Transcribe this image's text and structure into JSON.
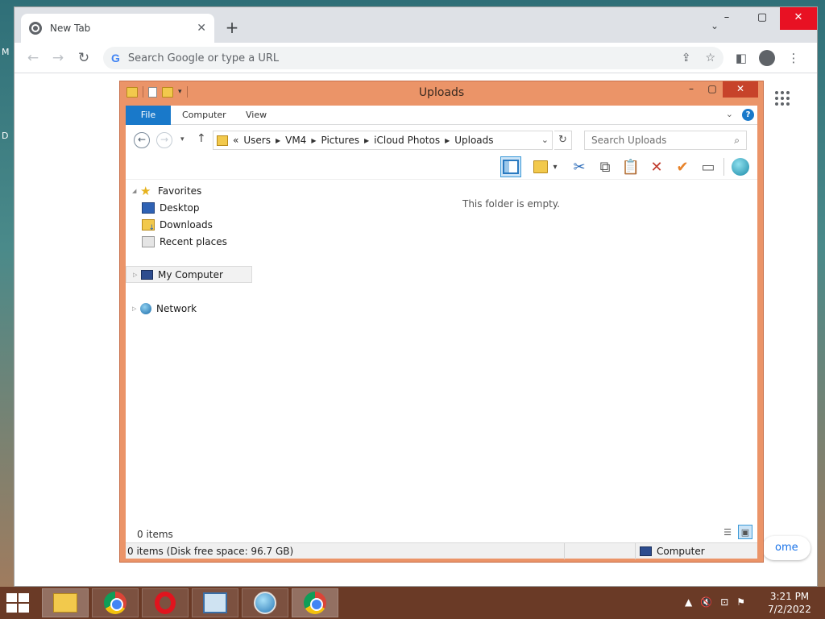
{
  "desktop": {
    "edge_letter_top": "M",
    "edge_letter_mid": "D"
  },
  "chrome": {
    "tab": {
      "title": "New Tab",
      "close_glyph": "✕",
      "favicon": "chrome-icon"
    },
    "new_tab_glyph": "+",
    "tab_search_glyph": "⌄",
    "window_controls": {
      "minimize": "–",
      "maximize": "▢",
      "close": "✕"
    },
    "nav": {
      "back": "←",
      "forward": "→",
      "reload": "↻"
    },
    "omnibox": {
      "placeholder": "Search Google or type a URL",
      "value": "",
      "g_letter": "G"
    },
    "omni_icons": {
      "share": "⇪",
      "bookmark": "☆"
    },
    "toolbar_icons": {
      "side_panel": "◧",
      "menu": "⋮"
    },
    "customize_label": "ome"
  },
  "explorer": {
    "title": "Uploads",
    "window_controls": {
      "minimize": "–",
      "maximize": "▢",
      "close": "✕"
    },
    "ribbon": {
      "tabs": [
        "File",
        "Computer",
        "View"
      ],
      "expand_glyph": "⌄",
      "help_glyph": "?"
    },
    "address": {
      "back": "←",
      "forward": "→",
      "dropdown": "▾",
      "up": "↑",
      "overflow": "«",
      "crumbs": [
        "Users",
        "VM4",
        "Pictures",
        "iCloud Photos",
        "Uploads"
      ],
      "crumb_sep": "▶",
      "caret": "⌄",
      "refresh": "↻"
    },
    "search": {
      "placeholder": "Search Uploads",
      "value": "",
      "glyph": "⌕"
    },
    "commands": {
      "cut": "✂",
      "copy": "⧉",
      "paste": "📋",
      "delete": "✕",
      "rename": "✔",
      "properties": "▭",
      "dropdown": "▾",
      "colors": {
        "delete": "#c0392b",
        "rename": "#e8832a",
        "cut": "#2a6ab8"
      }
    },
    "nav_pane": {
      "expander": "◢",
      "collapsed": "▷",
      "favorites": "Favorites",
      "star": "★",
      "favorite_items": [
        "Desktop",
        "Downloads",
        "Recent places"
      ],
      "computer": "My Computer",
      "network": "Network"
    },
    "content": {
      "empty_message": "This folder is empty."
    },
    "footer": {
      "items_count": "0 items",
      "view_details": "☰",
      "view_icons": "▣"
    },
    "status": {
      "left": "0 items (Disk free space: 96.7 GB)",
      "right": "Computer"
    }
  },
  "taskbar": {
    "tray": {
      "up_arrow": "▲",
      "volume": "🔇",
      "network": "⊡",
      "flag": "⚑"
    },
    "clock": {
      "time": "3:21 PM",
      "date": "7/2/2022"
    }
  }
}
